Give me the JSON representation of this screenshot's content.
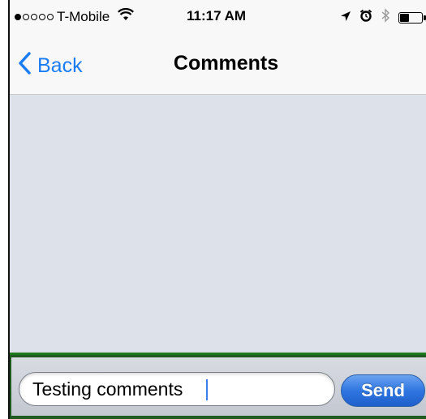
{
  "status_bar": {
    "signal_filled": 1,
    "signal_total": 5,
    "carrier": "T-Mobile",
    "wifi_icon": "wifi-icon",
    "time": "11:17 AM",
    "location_icon": "location-arrow-icon",
    "alarm_icon": "alarm-clock-icon",
    "bluetooth_icon": "bluetooth-icon",
    "battery_level": 0.45
  },
  "nav": {
    "back_label": "Back",
    "back_icon": "chevron-left-icon",
    "title": "Comments"
  },
  "composer": {
    "input_value": "Testing comments",
    "send_label": "Send"
  },
  "colors": {
    "accent": "#1a7cf5",
    "content_bg": "#dde1ea",
    "toolbar_border": "#1f5b20",
    "send_button": "#2f76e1"
  }
}
